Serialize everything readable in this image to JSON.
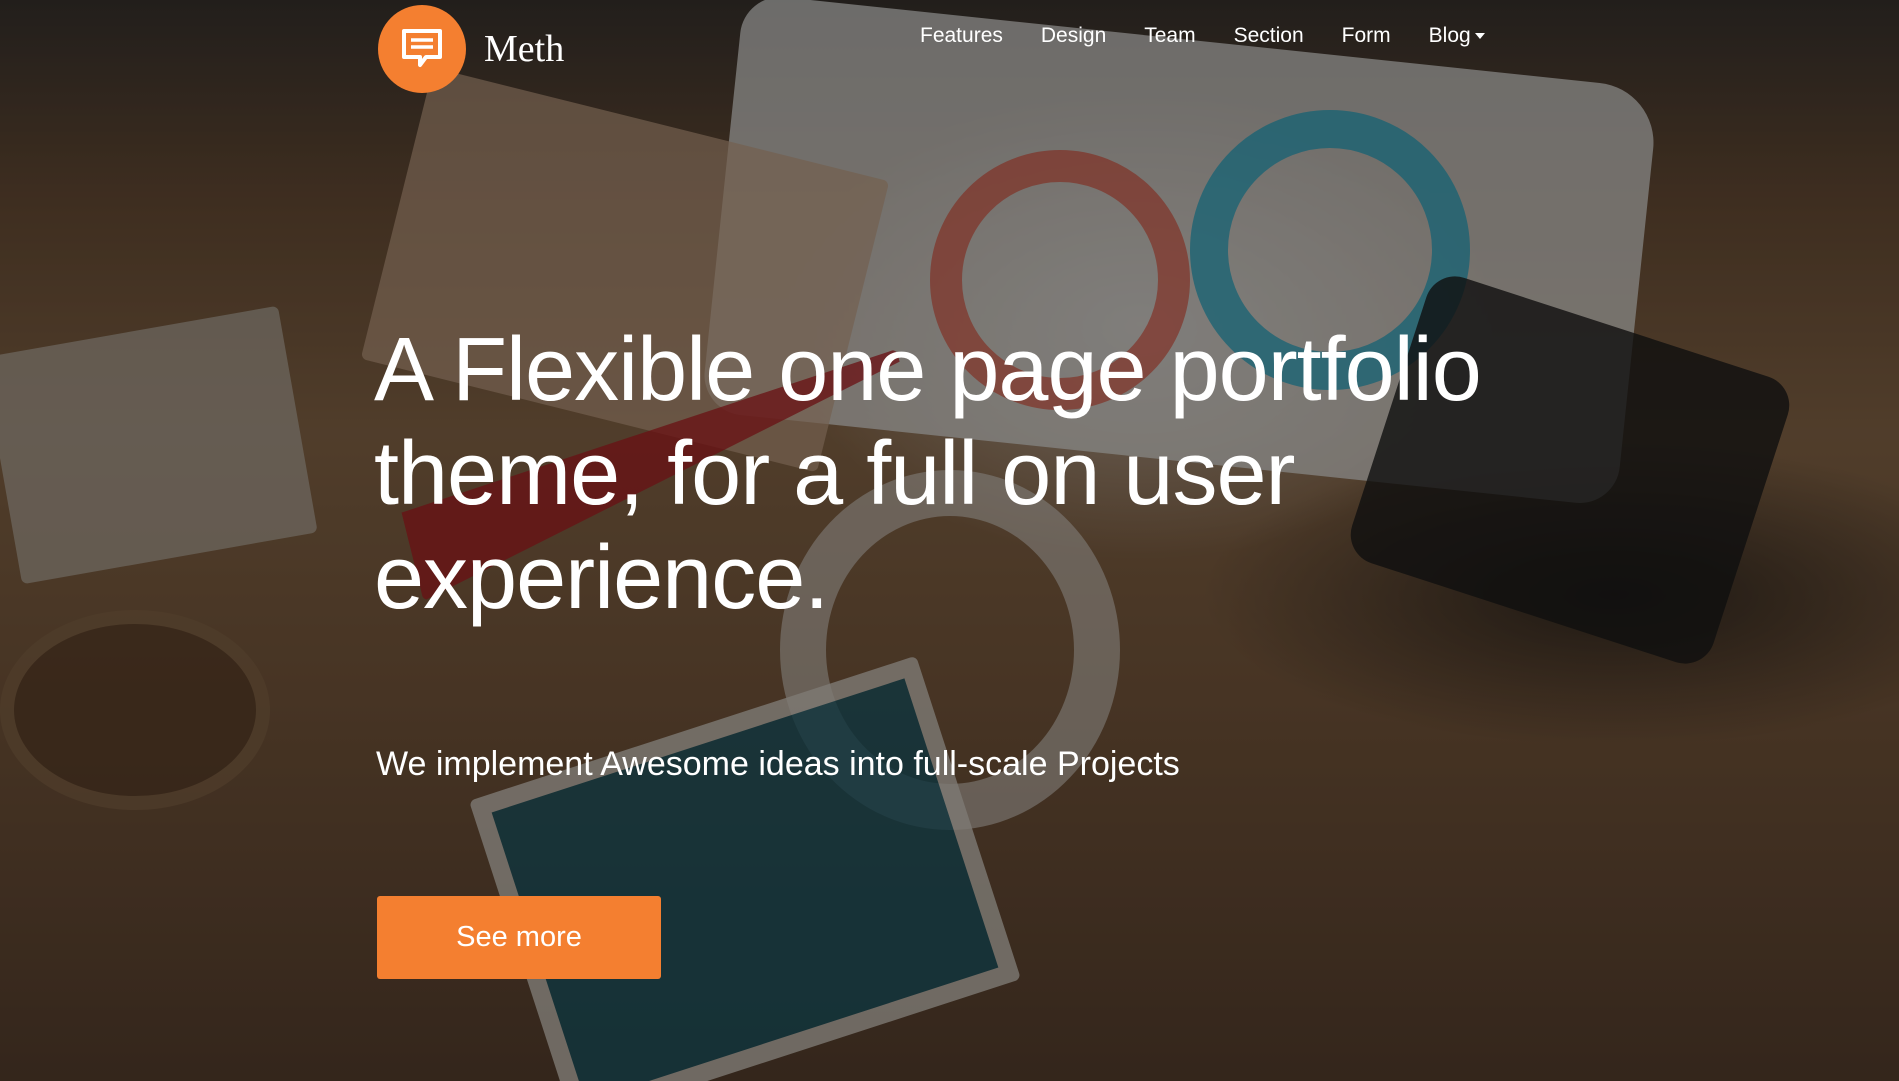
{
  "brand": {
    "name": "Meth",
    "icon": "chat-bubble-icon",
    "accent_color": "#f47f30"
  },
  "nav": {
    "items": [
      {
        "label": "Features"
      },
      {
        "label": "Design"
      },
      {
        "label": "Team"
      },
      {
        "label": "Section"
      },
      {
        "label": "Form"
      },
      {
        "label": "Blog",
        "dropdown": true,
        "icon": "caret-down-icon"
      }
    ]
  },
  "hero": {
    "headline": "A Flexible one page portfolio theme, for a full on user experience.",
    "subheadline": "We implement Awesome ideas into full-scale Projects",
    "cta_label": "See more",
    "background": "desk-flatlay-photo"
  }
}
